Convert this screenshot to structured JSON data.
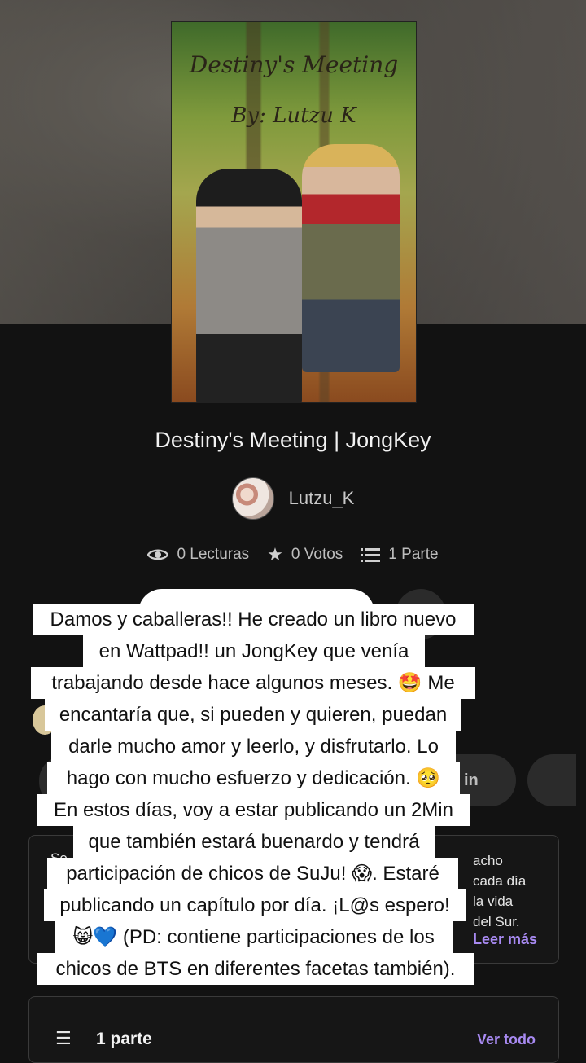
{
  "cover": {
    "title_text": "Destiny's Meeting",
    "byline_text": "By: Lutzu K"
  },
  "story": {
    "title": "Destiny's Meeting | JongKey",
    "author": "Lutzu_K",
    "reads": "0 Lecturas",
    "votes": "0 Votos",
    "parts": "1 Parte"
  },
  "tags": {
    "partial_tag": "in"
  },
  "description": {
    "left_fragment": "Se",
    "right_lines": [
      "acho",
      "cada día",
      "la vida",
      "del Sur."
    ],
    "read_more": "Leer más"
  },
  "parts_section": {
    "label": "1 parte",
    "view_all": "Ver todo"
  },
  "caption_overlay": {
    "lines": [
      "Damos y caballeras!! He creado un libro nuevo",
      "en Wattpad!! un JongKey que venía",
      "trabajando desde hace algunos meses. 🤩 Me",
      "encantaría que, si pueden y quieren, puedan",
      "darle mucho amor y leerlo, y disfrutarlo. Lo",
      "hago con mucho esfuerzo y dedicación. 🥺",
      "En estos días, voy a estar publicando un 2Min",
      "que también estará buenardo y tendrá",
      "participación de chicos de SuJu! 😱. Estaré",
      "publicando un capítulo por día. ¡L@s espero!",
      "😸💙 (PD: contiene participaciones de los",
      "chicos de BTS en diferentes facetas también)."
    ]
  },
  "icons": {
    "reads": "eye-icon",
    "votes": "star-icon",
    "parts": "list-icon"
  }
}
